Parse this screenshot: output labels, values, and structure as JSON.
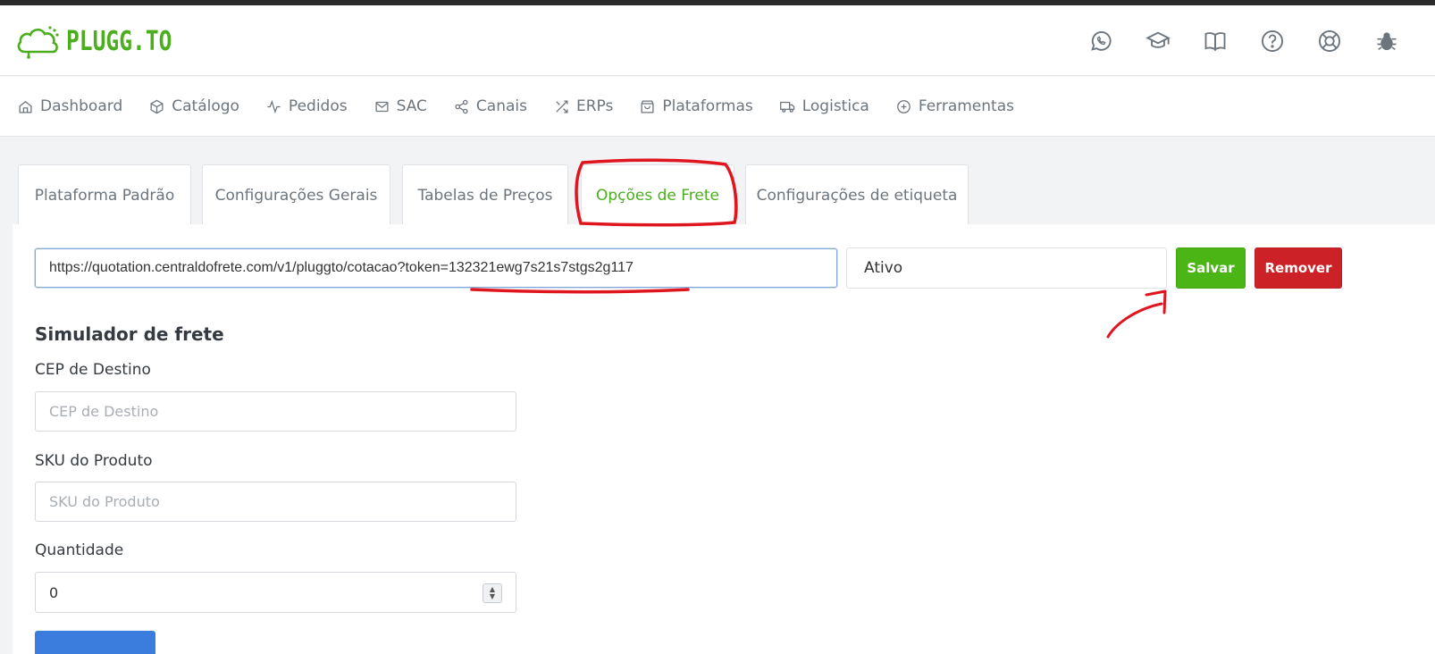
{
  "brand": {
    "logo_text": "PLUGG.TO",
    "accent_color": "#4bae1e"
  },
  "header_icons": [
    {
      "name": "whatsapp-icon"
    },
    {
      "name": "graduation-cap-icon"
    },
    {
      "name": "book-icon"
    },
    {
      "name": "help-circle-icon"
    },
    {
      "name": "lifebuoy-icon"
    },
    {
      "name": "bug-icon"
    }
  ],
  "nav": {
    "items": [
      {
        "label": "Dashboard",
        "icon": "home-icon"
      },
      {
        "label": "Catálogo",
        "icon": "box-icon"
      },
      {
        "label": "Pedidos",
        "icon": "activity-icon"
      },
      {
        "label": "SAC",
        "icon": "mail-icon"
      },
      {
        "label": "Canais",
        "icon": "share-icon"
      },
      {
        "label": "ERPs",
        "icon": "shuffle-icon"
      },
      {
        "label": "Plataformas",
        "icon": "shopping-bag-icon"
      },
      {
        "label": "Logistica",
        "icon": "truck-icon"
      },
      {
        "label": "Ferramentas",
        "icon": "plus-circle-icon"
      }
    ]
  },
  "tabs": [
    {
      "label": "Plataforma Padrão",
      "active": false
    },
    {
      "label": "Configurações Gerais",
      "active": false
    },
    {
      "label": "Tabelas de Preços",
      "active": false
    },
    {
      "label": "Opções de Frete",
      "active": true
    },
    {
      "label": "Configurações de etiqueta",
      "active": false
    }
  ],
  "freight": {
    "url_value": "https://quotation.centraldofrete.com/v1/pluggto/cotacao?token=132321ewg7s21s7stgs2g117",
    "status": "Ativo",
    "save_label": "Salvar",
    "remove_label": "Remover",
    "save_color": "#4bb516",
    "remove_color": "#cc2127"
  },
  "simulator": {
    "title": "Simulador de frete",
    "cep_label": "CEP de Destino",
    "cep_placeholder": "CEP de Destino",
    "sku_label": "SKU do Produto",
    "sku_placeholder": "SKU do Produto",
    "qty_label": "Quantidade",
    "qty_value": "0"
  },
  "annotation_color": "#e0161e"
}
